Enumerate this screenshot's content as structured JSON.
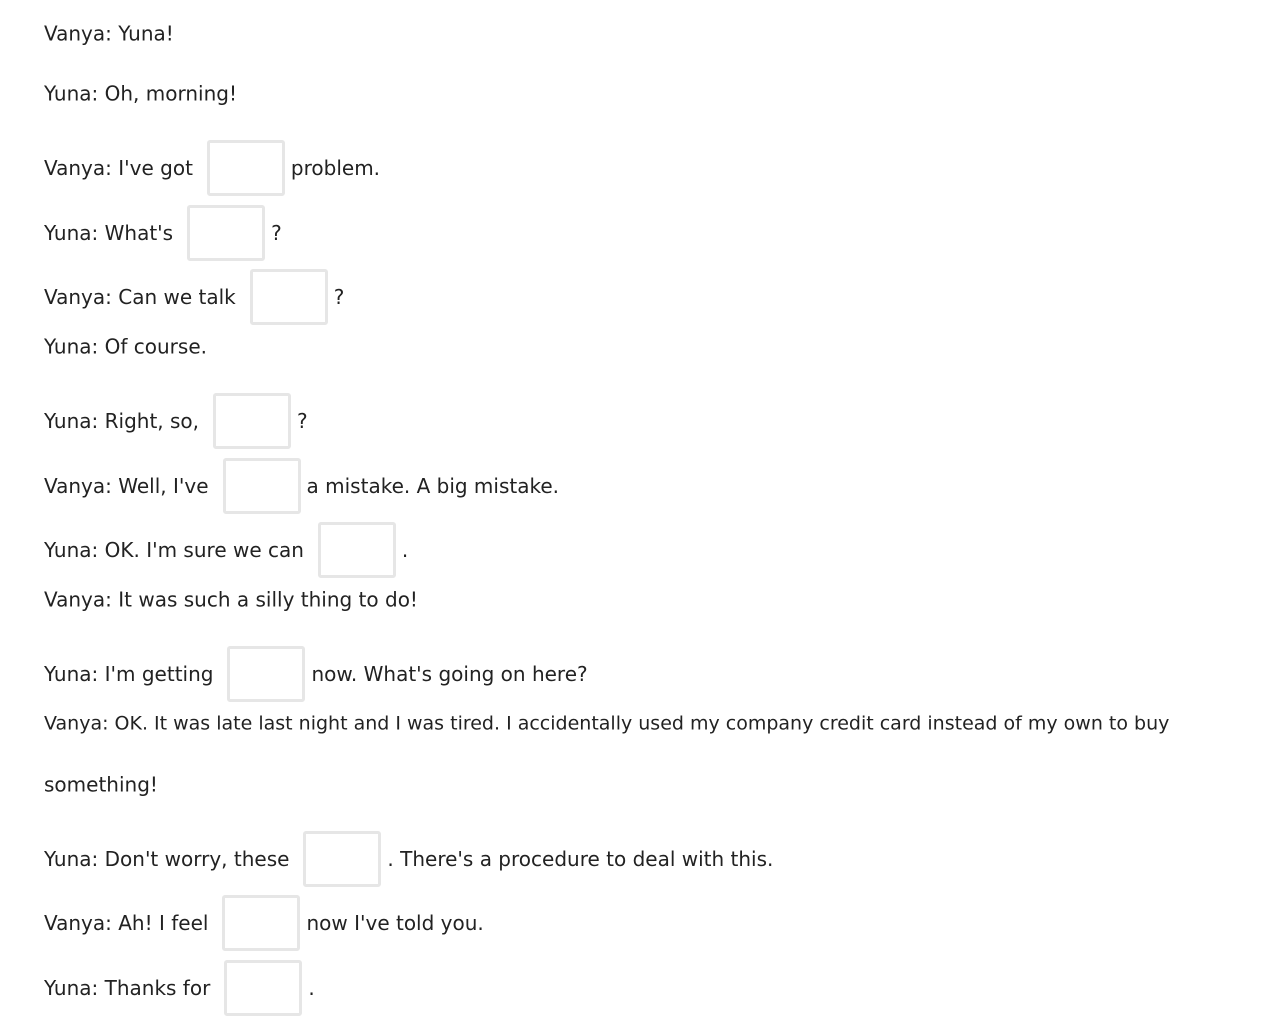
{
  "dialogue": [
    {
      "pre": "Vanya: Yuna!",
      "post": "",
      "gap": false
    },
    {
      "pre": "Yuna: Oh, morning!",
      "post": "",
      "gap": false
    },
    {
      "pre": "Vanya: I've got",
      "post": "problem.",
      "gap": true
    },
    {
      "pre": "Yuna: What's",
      "post": "?",
      "gap": true
    },
    {
      "pre": "Vanya: Can we talk",
      "post": "?",
      "gap": true
    },
    {
      "pre": "Yuna: Of course.",
      "post": "",
      "gap": false
    },
    {
      "pre": "Yuna: Right, so,",
      "post": "?",
      "gap": true
    },
    {
      "pre": "Vanya: Well, I've",
      "post": "a mistake. A big mistake.",
      "gap": true
    },
    {
      "pre": "Yuna: OK. I'm sure we can",
      "post": ".",
      "gap": true
    },
    {
      "pre": "Vanya: It was such a silly thing to do!",
      "post": "",
      "gap": false
    },
    {
      "pre": "Yuna: I'm getting",
      "post": "now. What's going on here?",
      "gap": true
    },
    {
      "pre": "Vanya: OK. It was late last night and I was tired. I accidentally used my company credit card instead of my own to buy",
      "post": "",
      "gap": false
    },
    {
      "pre": "something!",
      "post": "",
      "gap": false
    },
    {
      "pre": "Yuna: Don't worry, these",
      "post": ". There's a procedure to deal with this.",
      "gap": true
    },
    {
      "pre": "Vanya: Ah! I feel",
      "post": "now I've told you.",
      "gap": true
    },
    {
      "pre": "Yuna: Thanks for",
      "post": ".",
      "gap": true
    }
  ]
}
